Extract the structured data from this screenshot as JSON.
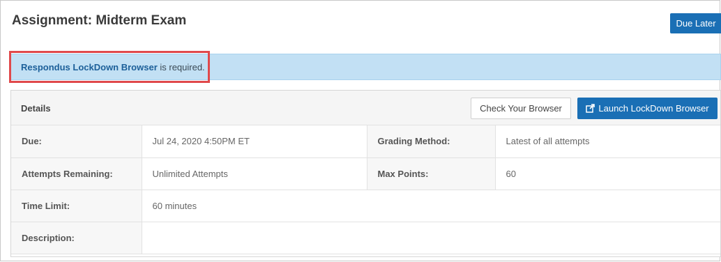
{
  "header": {
    "title": "Assignment: Midterm Exam",
    "due_button": "Due Later"
  },
  "alert": {
    "link_text": "Respondus LockDown Browser",
    "suffix": " is required."
  },
  "details_panel": {
    "title": "Details",
    "check_button": "Check Your Browser",
    "launch_button": "Launch LockDown Browser",
    "launch_icon": "external-link-icon",
    "rows": [
      {
        "label1": "Due:",
        "value1": "Jul 24, 2020 4:50PM ET",
        "label2": "Grading Method:",
        "value2": "Latest of all attempts"
      },
      {
        "label1": "Attempts Remaining:",
        "value1": "Unlimited Attempts",
        "label2": "Max Points:",
        "value2": "60"
      },
      {
        "label1": "Time Limit:",
        "value1": "60 minutes"
      },
      {
        "label1": "Description:",
        "value1": ""
      }
    ]
  },
  "colors": {
    "primary": "#1a6fb5",
    "alert_bg": "#c2e0f4",
    "highlight": "#e0494b"
  }
}
